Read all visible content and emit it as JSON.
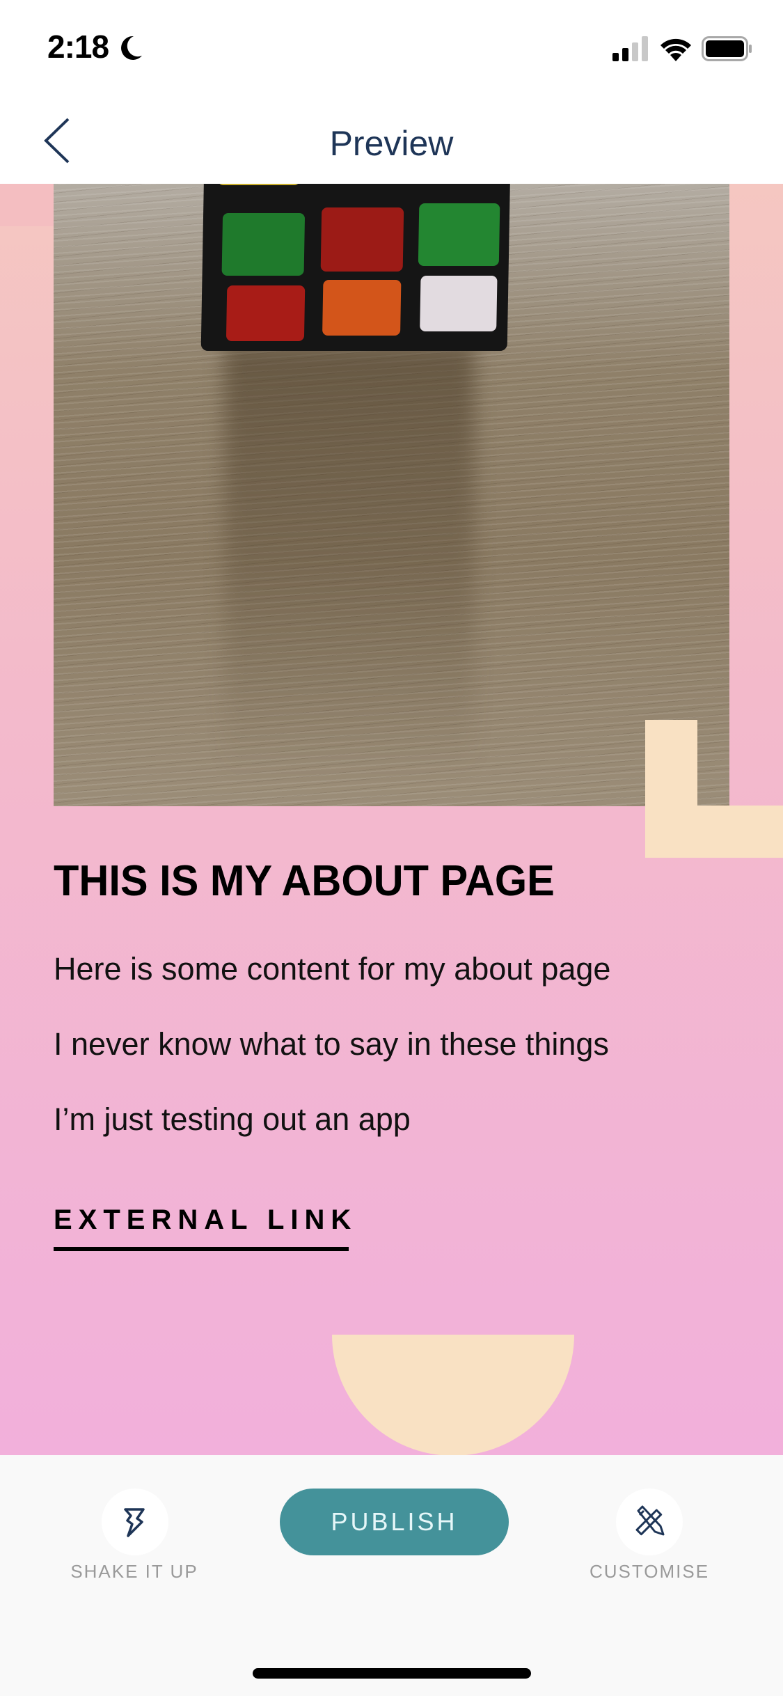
{
  "status_bar": {
    "time": "2:18",
    "icons": [
      "moon-icon",
      "signal-icon",
      "wifi-icon",
      "battery-icon"
    ]
  },
  "nav": {
    "title": "Preview",
    "back_icon": "chevron-left-icon"
  },
  "preview": {
    "colors": {
      "background_top": "#f5c7c1",
      "background_bottom": "#f2b0db",
      "accent_shape": "#f9e1c3"
    },
    "photo": {
      "description": "Rubik's cube on wooden table"
    },
    "heading": "THIS IS MY ABOUT PAGE",
    "paragraphs": [
      "Here is some content for my about page",
      "I never know what to say in these things",
      "I’m just testing out an app"
    ],
    "link_label": "EXTERNAL LINK"
  },
  "bottom_bar": {
    "shake_label": "SHAKE IT UP",
    "shake_icon": "lightning-bolt-icon",
    "publish_label": "PUBLISH",
    "publish_color": "#44929a",
    "customise_label": "CUSTOMISE",
    "customise_icon": "pencil-ruler-icon"
  }
}
